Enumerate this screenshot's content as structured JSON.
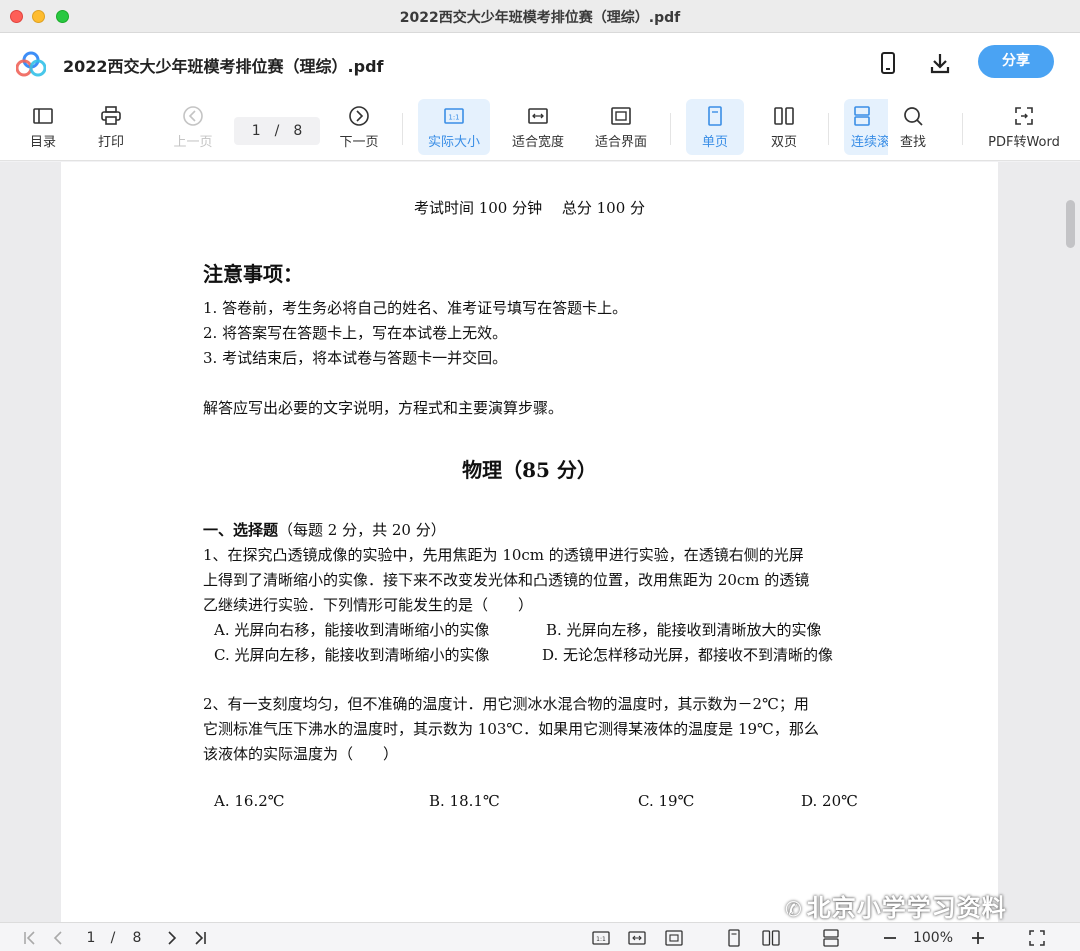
{
  "window": {
    "title": "2022西交大少年班模考排位赛（理综）.pdf"
  },
  "header": {
    "doc_title": "2022西交大少年班模考排位赛（理综）.pdf",
    "share_label": "分享"
  },
  "toolbar": {
    "toc": "目录",
    "print": "打印",
    "prev": "上一页",
    "page_current": "1",
    "page_sep": "/",
    "page_total": "8",
    "next": "下一页",
    "actual_size": "实际大小",
    "fit_width": "适合宽度",
    "fit_page": "适合界面",
    "single": "单页",
    "double": "双页",
    "continuous": "连续滚",
    "find": "查找",
    "to_word": "PDF转Word"
  },
  "document": {
    "exam_info": "考试时间 100 分钟　 总分 100 分",
    "notice_title": "注意事项：",
    "notices": [
      "1.  答卷前，考生务必将自己的姓名、准考证号填写在答题卡上。",
      "2.  将答案写在答题卡上，写在本试卷上无效。",
      "3.  考试结束后，将本试卷与答题卡一并交回。"
    ],
    "instruction": "解答应写出必要的文字说明，方程式和主要演算步骤。",
    "section_title": "物理（85 分）",
    "part_title_bold": "一、选择题",
    "part_title_rest": "（每题 2 分，共 20 分）",
    "q1_lines": [
      "1、在探究凸透镜成像的实验中，先用焦距为 10cm 的透镜甲进行实验，在透镜右侧的光屏",
      "上得到了清晰缩小的实像．接下来不改变发光体和凸透镜的位置，改用焦距为 20cm 的透镜",
      "乙继续进行实验．下列情形可能发生的是（　　）"
    ],
    "q1_options": {
      "a": "A. 光屏向右移，能接收到清晰缩小的实像",
      "b": "B. 光屏向左移，能接收到清晰放大的实像",
      "c": "C. 光屏向左移，能接收到清晰缩小的实像",
      "d": "D. 无论怎样移动光屏，都接收不到清晰的像"
    },
    "q2_lines": [
      "2、有一支刻度均匀，但不准确的温度计．用它测冰水混合物的温度时，其示数为－2℃；用",
      "它测标准气压下沸水的温度时，其示数为 103℃．如果用它测得某液体的温度是 19℃，那么",
      "该液体的实际温度为（　　）"
    ],
    "q2_options": {
      "a": "A.  16.2℃",
      "b": "B. 18.1℃",
      "c": "C. 19℃",
      "d": "D. 20℃"
    }
  },
  "bottombar": {
    "page_current": "1",
    "page_sep": "/",
    "page_total": "8",
    "zoom": "100%"
  },
  "watermark": "北京小学学习资料",
  "colors": {
    "accent": "#4aa3f3",
    "active_bg": "#e5f1fd",
    "active_text": "#3a8ee6"
  }
}
